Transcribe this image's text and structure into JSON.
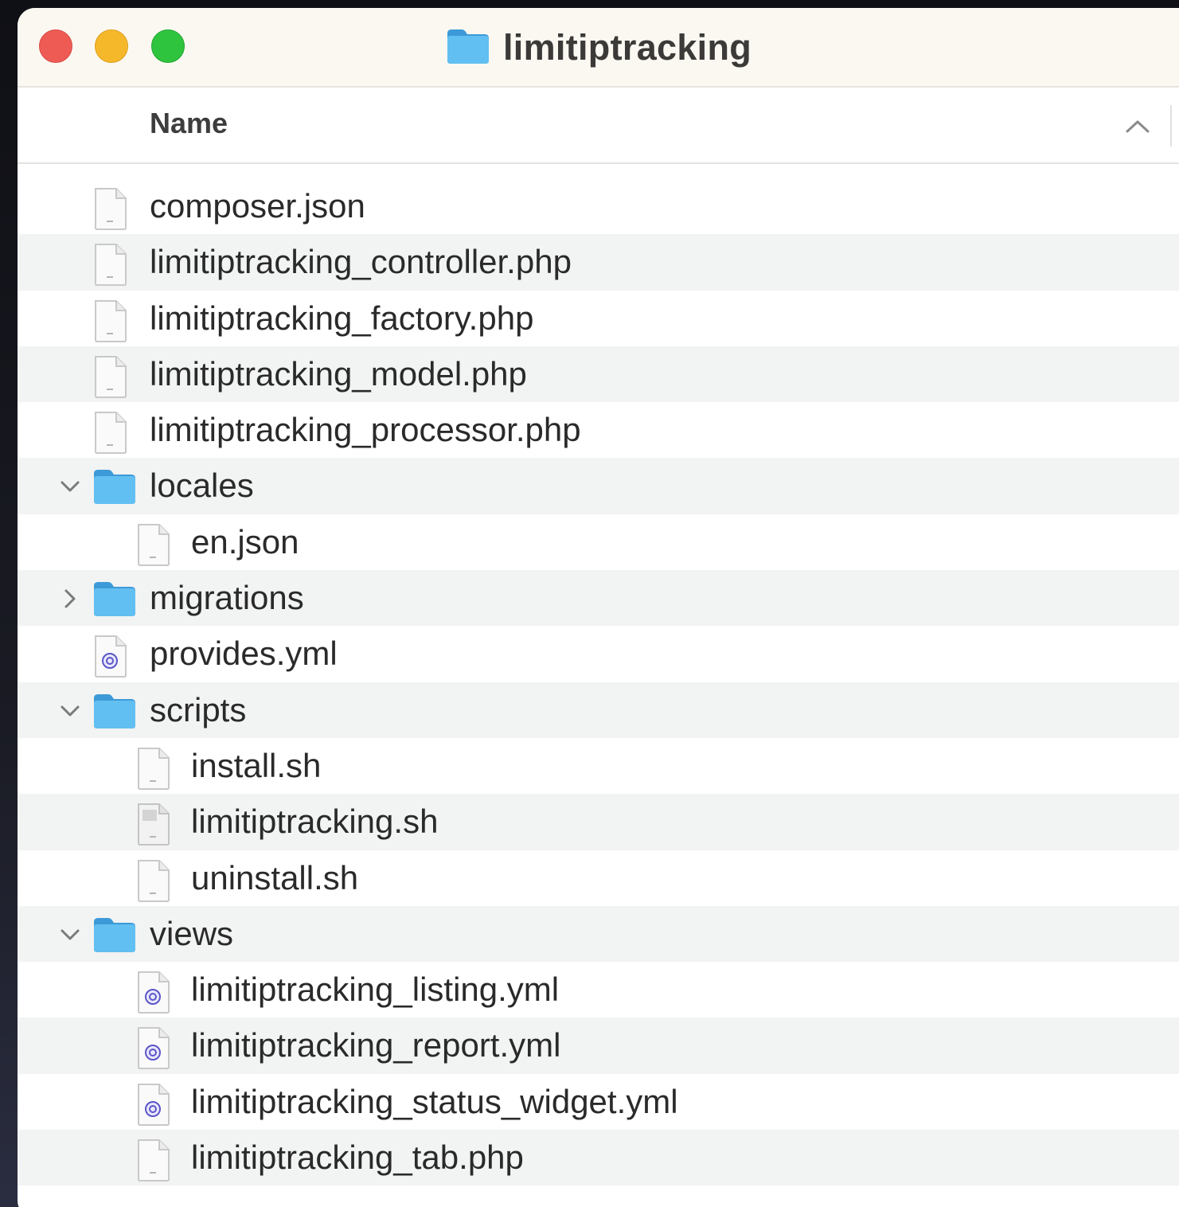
{
  "window": {
    "title": "limitiptracking",
    "title_icon": "folder-icon"
  },
  "header": {
    "name_label": "Name",
    "sort_icon": "chevron-up-icon",
    "sort": "ascending"
  },
  "colors": {
    "close": "#ee5b55",
    "minimize": "#f6b82b",
    "zoom": "#2fc43e",
    "folder": "#5ab4ec",
    "row_alt": "#f2f3f3"
  },
  "items": [
    {
      "name": "composer.json",
      "kind": "file",
      "icon": "document-icon",
      "depth": 0
    },
    {
      "name": "limitiptracking_controller.php",
      "kind": "file",
      "icon": "document-icon",
      "depth": 0
    },
    {
      "name": "limitiptracking_factory.php",
      "kind": "file",
      "icon": "document-icon",
      "depth": 0
    },
    {
      "name": "limitiptracking_model.php",
      "kind": "file",
      "icon": "document-icon",
      "depth": 0
    },
    {
      "name": "limitiptracking_processor.php",
      "kind": "file",
      "icon": "document-icon",
      "depth": 0
    },
    {
      "name": "locales",
      "kind": "folder",
      "icon": "folder-icon",
      "depth": 0,
      "expanded": true
    },
    {
      "name": "en.json",
      "kind": "file",
      "icon": "document-icon",
      "depth": 1
    },
    {
      "name": "migrations",
      "kind": "folder",
      "icon": "folder-icon",
      "depth": 0,
      "expanded": false
    },
    {
      "name": "provides.yml",
      "kind": "file",
      "icon": "yaml-file-icon",
      "depth": 0
    },
    {
      "name": "scripts",
      "kind": "folder",
      "icon": "folder-icon",
      "depth": 0,
      "expanded": true
    },
    {
      "name": "install.sh",
      "kind": "file",
      "icon": "document-icon",
      "depth": 1
    },
    {
      "name": "limitiptracking.sh",
      "kind": "file",
      "icon": "script-file-icon",
      "depth": 1
    },
    {
      "name": "uninstall.sh",
      "kind": "file",
      "icon": "document-icon",
      "depth": 1
    },
    {
      "name": "views",
      "kind": "folder",
      "icon": "folder-icon",
      "depth": 0,
      "expanded": true
    },
    {
      "name": "limitiptracking_listing.yml",
      "kind": "file",
      "icon": "yaml-file-icon",
      "depth": 1
    },
    {
      "name": "limitiptracking_report.yml",
      "kind": "file",
      "icon": "yaml-file-icon",
      "depth": 1
    },
    {
      "name": "limitiptracking_status_widget.yml",
      "kind": "file",
      "icon": "yaml-file-icon",
      "depth": 1
    },
    {
      "name": "limitiptracking_tab.php",
      "kind": "file",
      "icon": "document-icon",
      "depth": 1
    }
  ]
}
